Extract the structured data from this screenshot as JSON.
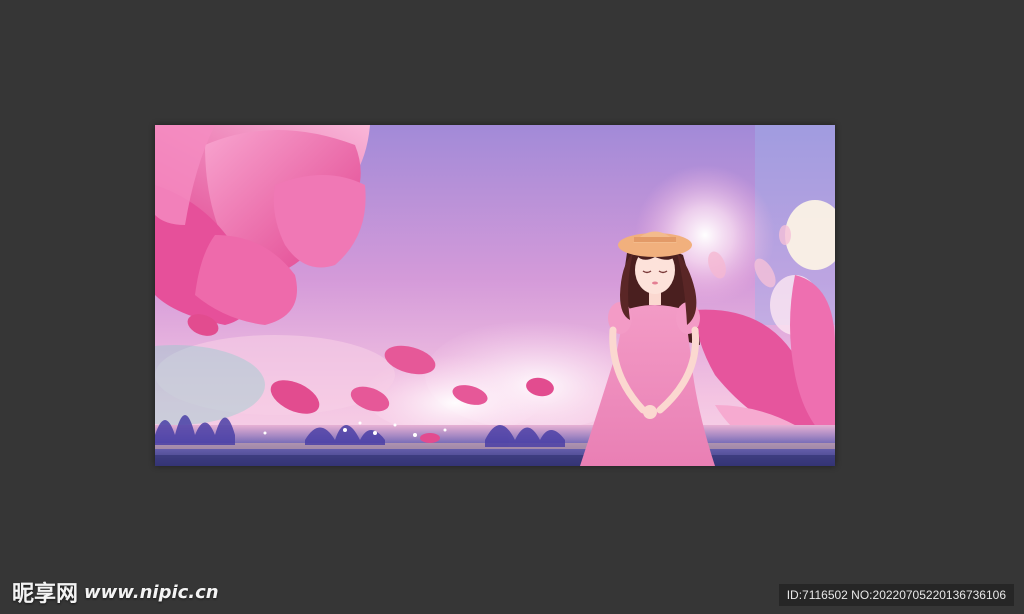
{
  "watermark": {
    "brand": "昵享网",
    "site": "www.nipic.cn"
  },
  "image_id": "ID:7116502 NO:20220705220136736106",
  "colors": {
    "background": "#363636",
    "sky_top": "#a98ad6",
    "sky_mid": "#e9a6d6",
    "petal": "#e8559b",
    "petal_light": "#f6a7cf",
    "dress": "#f08bbd",
    "hair": "#4a1f1f",
    "hat": "#f1b07d",
    "water": "#5a5aa8"
  }
}
